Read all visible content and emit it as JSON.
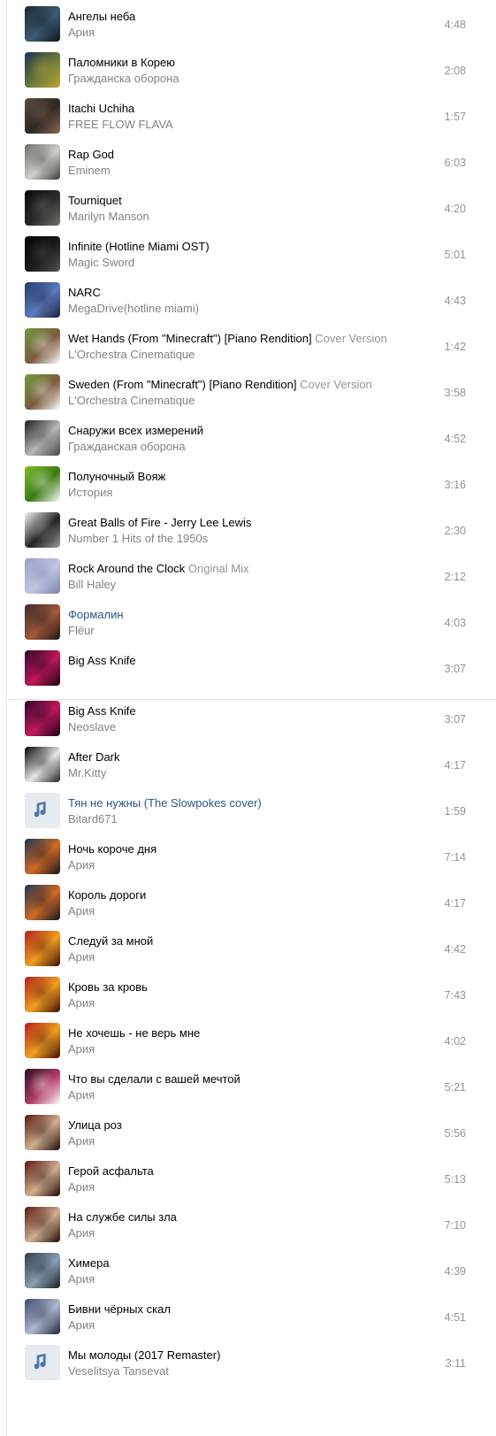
{
  "playlist_top": [
    {
      "title": "Ангелы неба",
      "subtitle": "",
      "artist": "Ария",
      "duration": "4:48",
      "cover": {
        "placeholder": false,
        "colors": [
          "#1b2735",
          "#3e5c72",
          "#0d131a"
        ]
      }
    },
    {
      "title": "Паломники в Корею",
      "subtitle": "",
      "artist": "Гражданска оборона",
      "duration": "2:08",
      "cover": {
        "placeholder": false,
        "colors": [
          "#23324a",
          "#6a7b3a",
          "#c7a236"
        ]
      }
    },
    {
      "title": "Itachi Uchiha",
      "subtitle": "",
      "artist": "FREE FLOW FLAVA",
      "duration": "1:57",
      "cover": {
        "placeholder": false,
        "colors": [
          "#5b4d42",
          "#2e2622",
          "#8a6a55"
        ]
      }
    },
    {
      "title": "Rap God",
      "subtitle": "",
      "artist": "Eminem",
      "duration": "6:03",
      "cover": {
        "placeholder": false,
        "colors": [
          "#6e6d68",
          "#d0cfc8",
          "#3a3a38"
        ]
      }
    },
    {
      "title": "Tourniquet",
      "subtitle": "",
      "artist": "Marilyn Manson",
      "duration": "4:20",
      "cover": {
        "placeholder": false,
        "colors": [
          "#0a0a0a",
          "#2d2b29",
          "#75706a"
        ]
      }
    },
    {
      "title": "Infinite (Hotline Miami OST)",
      "subtitle": "",
      "artist": "Magic Sword",
      "duration": "5:01",
      "cover": {
        "placeholder": false,
        "colors": [
          "#050505",
          "#1a1a1a",
          "#535353"
        ]
      }
    },
    {
      "title": "NARC",
      "subtitle": "",
      "artist": "MegaDrive(hotline miami)",
      "duration": "4:43",
      "cover": {
        "placeholder": false,
        "colors": [
          "#27396a",
          "#5a7cc0",
          "#1a1f3a"
        ]
      }
    },
    {
      "title": "Wet Hands (From \"Minecraft\") [Piano Rendition]",
      "subtitle": "Cover Version",
      "artist": "L'Orchestra Cinematique",
      "duration": "1:42",
      "cover": {
        "placeholder": false,
        "colors": [
          "#6f9d3a",
          "#7b5a3e",
          "#ffffff"
        ]
      }
    },
    {
      "title": "Sweden (From \"Minecraft\") [Piano Rendition]",
      "subtitle": "Cover Version",
      "artist": "L'Orchestra Cinematique",
      "duration": "3:58",
      "cover": {
        "placeholder": false,
        "colors": [
          "#6f9d3a",
          "#7b5a3e",
          "#ffffff"
        ]
      }
    },
    {
      "title": "Снаружи всех измерений",
      "subtitle": "",
      "artist": "Гражданская оборона",
      "duration": "4:52",
      "cover": {
        "placeholder": false,
        "colors": [
          "#1c1c1c",
          "#b8b8b8",
          "#444444"
        ]
      }
    },
    {
      "title": "Полуночный Вояж",
      "subtitle": "",
      "artist": "История",
      "duration": "3:16",
      "cover": {
        "placeholder": false,
        "colors": [
          "#7fbd2a",
          "#3b7a13",
          "#ffffff"
        ]
      }
    },
    {
      "title": "Great Balls of Fire - Jerry Lee Lewis",
      "subtitle": "",
      "artist": "Number 1 Hits of the 1950s",
      "duration": "2:30",
      "cover": {
        "placeholder": false,
        "colors": [
          "#f4f4f4",
          "#222222",
          "#9a9a9a"
        ]
      }
    },
    {
      "title": "Rock Around the Clock",
      "subtitle": "Original Mix",
      "artist": "Bill Haley",
      "duration": "2:12",
      "cover": {
        "placeholder": false,
        "colors": [
          "#9aa0c8",
          "#c2c6e0",
          "#7b80ad"
        ]
      }
    },
    {
      "title": "Формалин",
      "subtitle": "",
      "artist": "Flëur",
      "duration": "4:03",
      "cover": {
        "placeholder": false,
        "colors": [
          "#3a2a2a",
          "#a05a3a",
          "#1e1414"
        ]
      },
      "linked": true
    },
    {
      "title": "Big Ass Knife",
      "subtitle": "",
      "artist": "",
      "duration": "3:07",
      "cover": {
        "placeholder": false,
        "colors": [
          "#2a0a2a",
          "#c2185b",
          "#120412"
        ]
      }
    }
  ],
  "playlist_bottom": [
    {
      "title": "Big Ass Knife",
      "subtitle": "",
      "artist": "Neoslave",
      "duration": "3:07",
      "cover": {
        "placeholder": false,
        "colors": [
          "#2a0a2a",
          "#c2185b",
          "#120412"
        ]
      }
    },
    {
      "title": "After Dark",
      "subtitle": "",
      "artist": "Mr.Kitty",
      "duration": "4:17",
      "cover": {
        "placeholder": false,
        "colors": [
          "#000000",
          "#e8e8e8",
          "#202020"
        ]
      }
    },
    {
      "title": "Тян не нужны (The Slowpokes cover)",
      "subtitle": "",
      "artist": "Bitard671",
      "duration": "1:59",
      "cover": {
        "placeholder": true,
        "colors": [
          "#e5ebf1",
          "#aab8ce",
          "#ffffff"
        ]
      },
      "linked": true
    },
    {
      "title": "Ночь короче дня",
      "subtitle": "",
      "artist": "Ария",
      "duration": "7:14",
      "cover": {
        "placeholder": false,
        "colors": [
          "#1b3552",
          "#d26a24",
          "#0b1420"
        ]
      }
    },
    {
      "title": "Король дороги",
      "subtitle": "",
      "artist": "Ария",
      "duration": "4:17",
      "cover": {
        "placeholder": false,
        "colors": [
          "#1b3552",
          "#d26a24",
          "#0b1420"
        ]
      }
    },
    {
      "title": "Следуй за мной",
      "subtitle": "",
      "artist": "Ария",
      "duration": "4:42",
      "cover": {
        "placeholder": false,
        "colors": [
          "#b21f1a",
          "#f0a020",
          "#3a0b08"
        ]
      }
    },
    {
      "title": "Кровь за кровь",
      "subtitle": "",
      "artist": "Ария",
      "duration": "7:43",
      "cover": {
        "placeholder": false,
        "colors": [
          "#b21f1a",
          "#f0a020",
          "#3a0b08"
        ]
      }
    },
    {
      "title": "Не хочешь - не верь мне",
      "subtitle": "",
      "artist": "Ария",
      "duration": "4:02",
      "cover": {
        "placeholder": false,
        "colors": [
          "#b21f1a",
          "#f0a020",
          "#3a0b08"
        ]
      }
    },
    {
      "title": "Что вы сделали с вашей мечтой",
      "subtitle": "",
      "artist": "Ария",
      "duration": "5:21",
      "cover": {
        "placeholder": false,
        "colors": [
          "#2a1020",
          "#b03a6a",
          "#ffffff"
        ]
      }
    },
    {
      "title": "Улица роз",
      "subtitle": "",
      "artist": "Ария",
      "duration": "5:56",
      "cover": {
        "placeholder": false,
        "colors": [
          "#5a1410",
          "#d0b090",
          "#1c0504"
        ]
      }
    },
    {
      "title": "Герой асфальта",
      "subtitle": "",
      "artist": "Ария",
      "duration": "5:13",
      "cover": {
        "placeholder": false,
        "colors": [
          "#5a1410",
          "#d0b090",
          "#1c0504"
        ]
      }
    },
    {
      "title": "На службе силы зла",
      "subtitle": "",
      "artist": "Ария",
      "duration": "7:10",
      "cover": {
        "placeholder": false,
        "colors": [
          "#5a1410",
          "#d0b090",
          "#1c0504"
        ]
      }
    },
    {
      "title": "Химера",
      "subtitle": "",
      "artist": "Ария",
      "duration": "4:39",
      "cover": {
        "placeholder": false,
        "colors": [
          "#2e3a4a",
          "#8aa0b4",
          "#151b22"
        ]
      }
    },
    {
      "title": "Бивни чёрных скал",
      "subtitle": "",
      "artist": "Ария",
      "duration": "4:51",
      "cover": {
        "placeholder": false,
        "colors": [
          "#3a4a6e",
          "#b0b8d0",
          "#1a2238"
        ]
      }
    },
    {
      "title": "Мы молоды (2017 Remaster)",
      "subtitle": "",
      "artist": "Veselitsya Tansevat",
      "duration": "3:11",
      "cover": {
        "placeholder": true,
        "colors": [
          "#e5ebf1",
          "#aab8ce",
          "#ffffff"
        ]
      }
    }
  ]
}
